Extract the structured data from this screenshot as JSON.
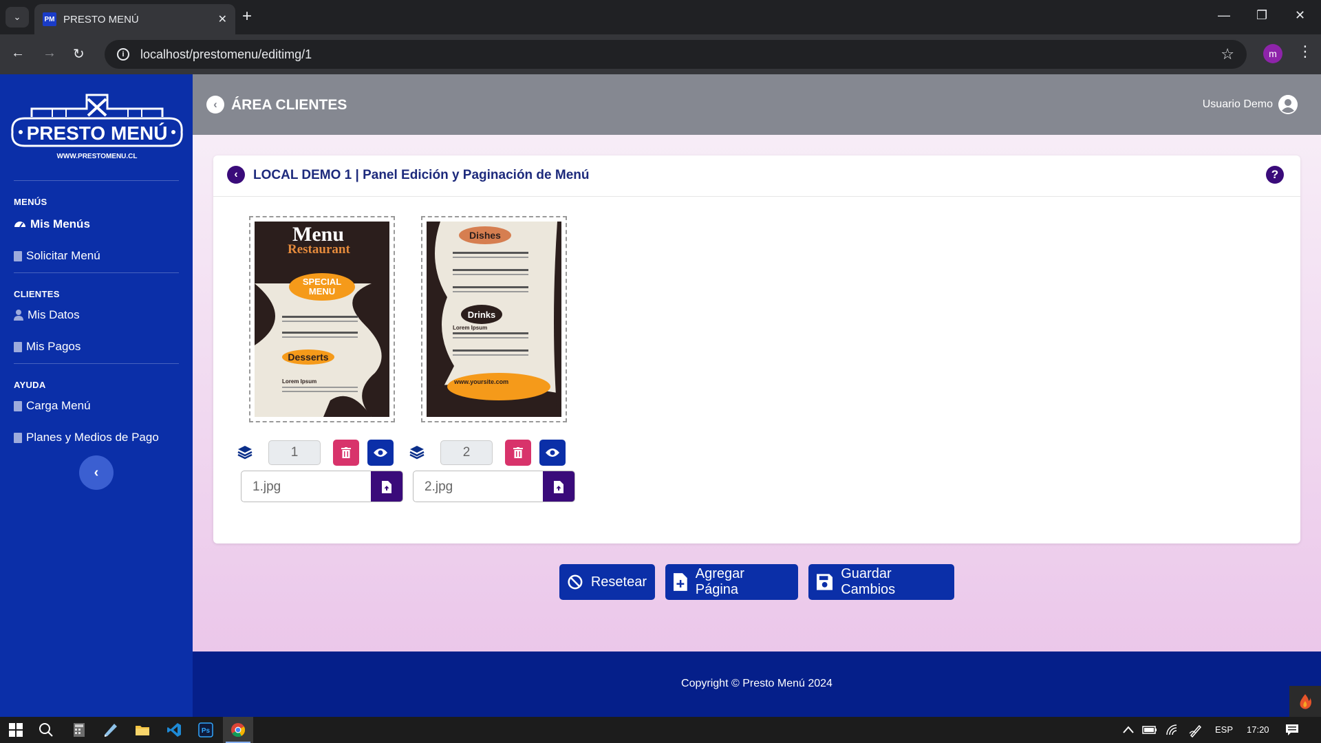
{
  "browser": {
    "tab_favicon": "PM",
    "tab_title": "PRESTO MENÚ",
    "url": "localhost/prestomenu/editimg/1",
    "profile_initial": "m"
  },
  "sidebar": {
    "logo": {
      "brand": "PRESTO MENÚ",
      "url": "WWW.PRESTOMENU.CL"
    },
    "sections": [
      {
        "heading": "MENÚS",
        "items": [
          "Mis Menús",
          "Solicitar Menú"
        ]
      },
      {
        "heading": "CLIENTES",
        "items": [
          "Mis Datos",
          "Mis Pagos"
        ]
      },
      {
        "heading": "AYUDA",
        "items": [
          "Carga Menú",
          "Planes y Medios de Pago"
        ]
      }
    ],
    "active_item": "Mis Menús"
  },
  "topbar": {
    "title": "ÁREA CLIENTES",
    "user": "Usuario Demo"
  },
  "card": {
    "title": "LOCAL DEMO 1 | Panel Edición y Paginación de Menú",
    "pages": [
      {
        "order": "1",
        "filename": "1.jpg",
        "thumb_texts": [
          "Menu",
          "Restaurant",
          "SPECIAL",
          "MENU",
          "Desserts",
          "Lorem Ipsum"
        ]
      },
      {
        "order": "2",
        "filename": "2.jpg",
        "thumb_texts": [
          "Dishes",
          "Drinks",
          "www.yoursite.com",
          "Lorem Ipsum"
        ]
      }
    ]
  },
  "actions": {
    "reset": "Resetear",
    "add_page": "Agregar Página",
    "save": "Guardar Cambios"
  },
  "footer": {
    "copyright": "Copyright © Presto Menú 2024"
  },
  "taskbar": {
    "language": "ESP",
    "time": "17:20"
  },
  "colors": {
    "sidebar": "#0b2fa8",
    "topbar": "#858891",
    "accent_purple": "#3a0b7a",
    "danger": "#d8336b",
    "footer": "#051f8a"
  }
}
